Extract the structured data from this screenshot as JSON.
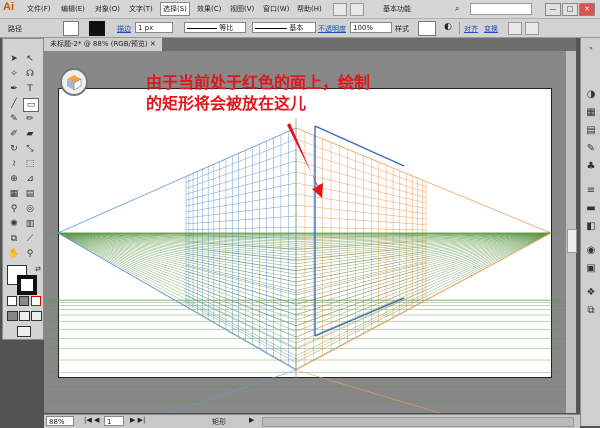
{
  "app": {
    "logo": "Ai"
  },
  "menu": {
    "items": [
      "文件(F)",
      "编辑(E)",
      "对象(O)",
      "文字(T)",
      "选择(S)",
      "效果(C)",
      "视图(V)",
      "窗口(W)",
      "帮助(H)"
    ],
    "active_index": 4,
    "workspace": "基本功能",
    "window_controls": [
      "—",
      "□",
      "✕"
    ]
  },
  "control": {
    "path_label": "路径",
    "stroke_label": "描边",
    "stroke_value": "1 px",
    "uniform_label": "等比",
    "basic_label": "基本",
    "opacity_label": "不透明度",
    "opacity_value": "100%",
    "style_label": "样式",
    "align_label": "对齐",
    "transform_label": "变换"
  },
  "document": {
    "tab_title": "未标题-2* @ 88% (RGB/预览)"
  },
  "annotation": {
    "line1": "由于当前处于红色的面上，绘制",
    "line2": "的矩形将会被放在这儿"
  },
  "status": {
    "zoom": "88%",
    "page": "1",
    "tool_name": "矩形"
  },
  "colors": {
    "left_grid": "#6d9ad6",
    "right_grid": "#f0a060",
    "ground_grid": "#5f9a4a",
    "annotation": "#e0161c",
    "arrow": "#e0161c",
    "rect_line": "#3b6cc4"
  }
}
